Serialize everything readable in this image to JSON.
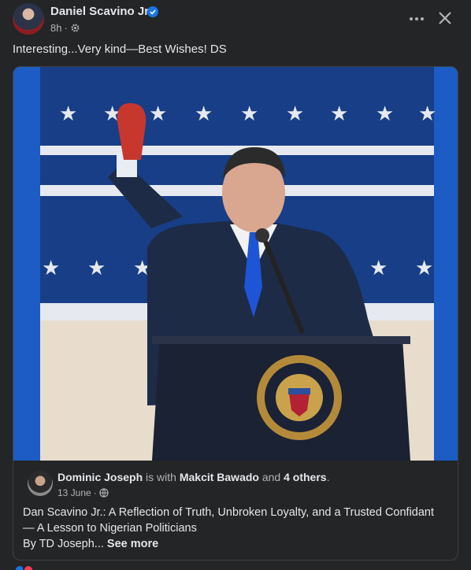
{
  "post": {
    "author": "Daniel Scavino Jr.",
    "time": "8h",
    "text": "Interesting...Very kind—Best Wishes! DS",
    "icons": [
      "verified-badge-icon",
      "audience-gear-icon",
      "more-options-icon",
      "close-icon"
    ]
  },
  "shared": {
    "author": "Dominic Joseph",
    "is_with_text": "is with",
    "tagged": "Makcit Bawado",
    "and_text": "and",
    "others": "4 others",
    "period": ".",
    "date": "13 June",
    "body_line1": "Dan Scavino Jr.: A Reflection of Truth, Unbroken Loyalty, and a Trusted Confidant",
    "body_line2": "— A Lesson to Nigerian Politicians",
    "body_line3": "By TD Joseph...",
    "see_more": "See more"
  },
  "photo": {
    "seal_text": "SEAL OF THE PRESIDENT OF THE UNITED STATES"
  },
  "colors": {
    "background": "#242526",
    "text_primary": "#e4e6eb",
    "text_secondary": "#b0b3b8",
    "verified": "#1b74e4",
    "photo_blue": "#1c5cc4"
  }
}
